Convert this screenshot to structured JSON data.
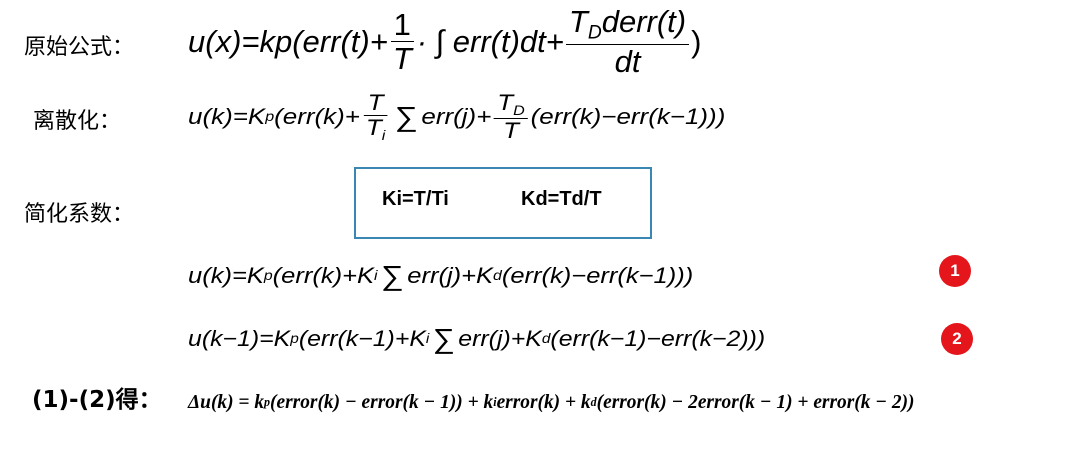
{
  "labels": {
    "original": "原始公式：",
    "discrete": "离散化：",
    "simplify": "简化系数：",
    "subtract": "(1)-(2)得："
  },
  "coef_box": {
    "ki": "Ki=T/Ti",
    "kd": "Kd=Td/T"
  },
  "eq_original": {
    "lhs": "u(x)=kp(err(t)+",
    "frac1_num": "1",
    "frac1_den": "T",
    "middle": "· ∫ err(t)dt+",
    "frac2_num_main": "T",
    "frac2_num_sub": "D",
    "frac2_num_tail": "derr(t)",
    "frac2_den": "dt",
    "end": ")"
  },
  "eq_discrete": {
    "lhs": "u(k)=K",
    "kp_sub": "p",
    "part1": "(err(k)+",
    "frac1_num": "T",
    "frac1_den_main": "T",
    "frac1_den_sub": "i",
    "sum": "∑",
    "part2": "err(j)+",
    "frac2_num_main": "T",
    "frac2_num_sub": "D",
    "frac2_den": "T",
    "part3": "(err(k)−err(k−1)))"
  },
  "eq_simplified_1": {
    "lhs": "u(k)=K",
    "kp_sub": "p",
    "part1": "(err(k)+K",
    "ki_sub": "i",
    "sum": "∑",
    "part2": "err(j)+K",
    "kd_sub": "d",
    "part3": "(err(k)−err(k−1)))"
  },
  "eq_simplified_2": {
    "lhs": "u(k−1)=K",
    "kp_sub": "p",
    "part1": "(err(k−1)+K",
    "ki_sub": "i",
    "sum": "∑",
    "part2": "err(j)+K",
    "kd_sub": "d",
    "part3": "(err(k−1)−err(k−2)))"
  },
  "eq_delta": {
    "lhs": "Δu(k) = k",
    "kp_sub": "p",
    "part1": "(error(k) − error(k − 1)) + k",
    "ki_sub": "i",
    "part2": "error(k) + k",
    "kd_sub": "d",
    "part3": "(error(k) − 2error(k − 1) + error(k − 2))"
  },
  "badges": {
    "one": "1",
    "two": "2"
  },
  "colors": {
    "box_border": "#3a87b3",
    "badge_fill": "#e5161b"
  }
}
